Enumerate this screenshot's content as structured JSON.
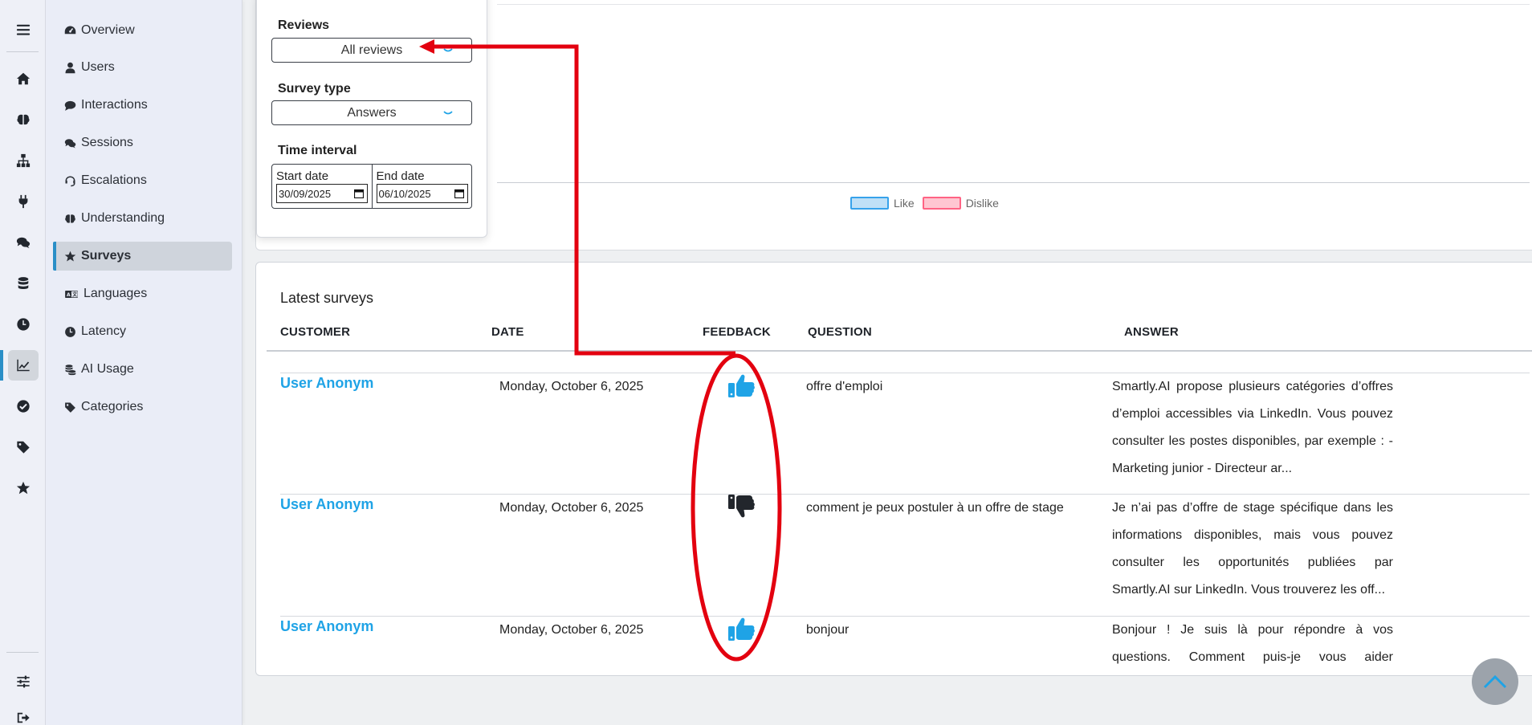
{
  "rail": {
    "items": [
      {
        "name": "menu-icon"
      },
      {
        "name": "home-icon"
      },
      {
        "name": "brain-icon"
      },
      {
        "name": "sitemap-icon"
      },
      {
        "name": "plug-icon"
      },
      {
        "name": "comments-icon"
      },
      {
        "name": "database-icon"
      },
      {
        "name": "clock-icon"
      },
      {
        "name": "chart-line-icon",
        "active": true
      },
      {
        "name": "check-circle-icon"
      },
      {
        "name": "tag-icon"
      },
      {
        "name": "star-icon"
      },
      {
        "name": "sliders-icon"
      },
      {
        "name": "logout-icon"
      }
    ]
  },
  "subnav": {
    "items": [
      {
        "label": "Overview",
        "icon": "dashboard-icon"
      },
      {
        "label": "Users",
        "icon": "user-icon"
      },
      {
        "label": "Interactions",
        "icon": "comment-icon"
      },
      {
        "label": "Sessions",
        "icon": "comments-icon"
      },
      {
        "label": "Escalations",
        "icon": "headset-icon"
      },
      {
        "label": "Understanding",
        "icon": "brain-icon"
      },
      {
        "label": "Surveys",
        "icon": "star-icon",
        "active": true
      },
      {
        "label": "Languages",
        "icon": "language-icon"
      },
      {
        "label": "Latency",
        "icon": "clock-icon"
      },
      {
        "label": "AI Usage",
        "icon": "coins-icon"
      },
      {
        "label": "Categories",
        "icon": "tag-icon"
      }
    ]
  },
  "filters": {
    "reviews_label": "Reviews",
    "reviews_value": "All reviews",
    "survey_type_label": "Survey type",
    "survey_type_value": "Answers",
    "time_interval_label": "Time interval",
    "start_label": "Start date",
    "start_value": "30/09/2025",
    "end_label": "End date",
    "end_value": "06/10/2025"
  },
  "chart": {
    "legend": [
      {
        "label": "Like",
        "border": "#36a2eb",
        "fill": "#bfe0f7"
      },
      {
        "label": "Dislike",
        "border": "#ff6384",
        "fill": "#ffc6d1"
      }
    ]
  },
  "surveys": {
    "title": "Latest surveys",
    "columns": {
      "customer": "CUSTOMER",
      "date": "DATE",
      "feedback": "FEEDBACK",
      "question": "QUESTION",
      "answer": "ANSWER"
    },
    "rows": [
      {
        "customer": "User Anonym",
        "date": "Monday, October 6, 2025",
        "feedback": "like",
        "question": "offre d'emploi",
        "answer": "Smartly.AI propose plusieurs catégories d’offres d’emploi accessibles via LinkedIn. Vous pouvez consulter les postes disponibles, par exemple : - Marketing junior - Directeur ar..."
      },
      {
        "customer": "User Anonym",
        "date": "Monday, October 6, 2025",
        "feedback": "dislike",
        "question": "comment je peux postuler à un offre de stage",
        "answer": "Je n’ai pas d’offre de stage spécifique dans les informations disponibles, mais vous pouvez consulter les opportunités publiées par Smartly.AI sur LinkedIn. Vous trouverez les off..."
      },
      {
        "customer": "User Anonym",
        "date": "Monday, October 6, 2025",
        "feedback": "like",
        "question": "bonjour",
        "answer": "Bonjour ! Je suis là pour répondre à vos questions. Comment puis-je vous aider aujourd’hui ?"
      }
    ]
  },
  "colors": {
    "accent": "#1fa3e6",
    "annotation": "#e3000f",
    "dislike_icon": "#22262c"
  }
}
